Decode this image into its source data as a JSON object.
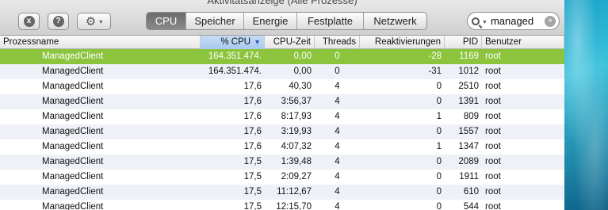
{
  "window": {
    "title": "Aktivitätsanzeige (Alle Prozesse)"
  },
  "toolbar": {
    "close_icon": "x",
    "info_icon": "?",
    "gear_icon": "⚙",
    "menu_caret": "▾"
  },
  "tabs": [
    {
      "label": "CPU",
      "active": true
    },
    {
      "label": "Speicher",
      "active": false
    },
    {
      "label": "Energie",
      "active": false
    },
    {
      "label": "Festplatte",
      "active": false
    },
    {
      "label": "Netzwerk",
      "active": false
    }
  ],
  "search": {
    "value": "managed",
    "placeholder": ""
  },
  "columns": [
    "Prozessname",
    "% CPU",
    "CPU-Zeit",
    "Threads",
    "Reaktivierungen",
    "PID",
    "Benutzer"
  ],
  "sorted_column": "% CPU",
  "sort_arrow": "▼",
  "colors": {
    "selection": "#8cc43e",
    "sorted_header": "#a8c8ef",
    "active_tab": "#7a7a7a"
  },
  "rows": [
    {
      "name": "ManagedClient",
      "cpu": "164.351.474.",
      "time": "0,00",
      "threads": "0",
      "wakeups": "-28",
      "pid": "1169",
      "user": "root",
      "selected": true
    },
    {
      "name": "ManagedClient",
      "cpu": "164.351.474.",
      "time": "0,00",
      "threads": "0",
      "wakeups": "-31",
      "pid": "1012",
      "user": "root"
    },
    {
      "name": "ManagedClient",
      "cpu": "17,6",
      "time": "40,30",
      "threads": "4",
      "wakeups": "0",
      "pid": "2510",
      "user": "root"
    },
    {
      "name": "ManagedClient",
      "cpu": "17,6",
      "time": "3:56,37",
      "threads": "4",
      "wakeups": "0",
      "pid": "1391",
      "user": "root"
    },
    {
      "name": "ManagedClient",
      "cpu": "17,6",
      "time": "8:17,93",
      "threads": "4",
      "wakeups": "1",
      "pid": "809",
      "user": "root"
    },
    {
      "name": "ManagedClient",
      "cpu": "17,6",
      "time": "3:19,93",
      "threads": "4",
      "wakeups": "0",
      "pid": "1557",
      "user": "root"
    },
    {
      "name": "ManagedClient",
      "cpu": "17,6",
      "time": "4:07,32",
      "threads": "4",
      "wakeups": "1",
      "pid": "1347",
      "user": "root"
    },
    {
      "name": "ManagedClient",
      "cpu": "17,5",
      "time": "1:39,48",
      "threads": "4",
      "wakeups": "0",
      "pid": "2089",
      "user": "root"
    },
    {
      "name": "ManagedClient",
      "cpu": "17,5",
      "time": "2:09,27",
      "threads": "4",
      "wakeups": "0",
      "pid": "1911",
      "user": "root"
    },
    {
      "name": "ManagedClient",
      "cpu": "17,5",
      "time": "11:12,67",
      "threads": "4",
      "wakeups": "0",
      "pid": "610",
      "user": "root"
    },
    {
      "name": "ManagedClient",
      "cpu": "17,5",
      "time": "12:15,70",
      "threads": "4",
      "wakeups": "0",
      "pid": "544",
      "user": "root"
    }
  ]
}
